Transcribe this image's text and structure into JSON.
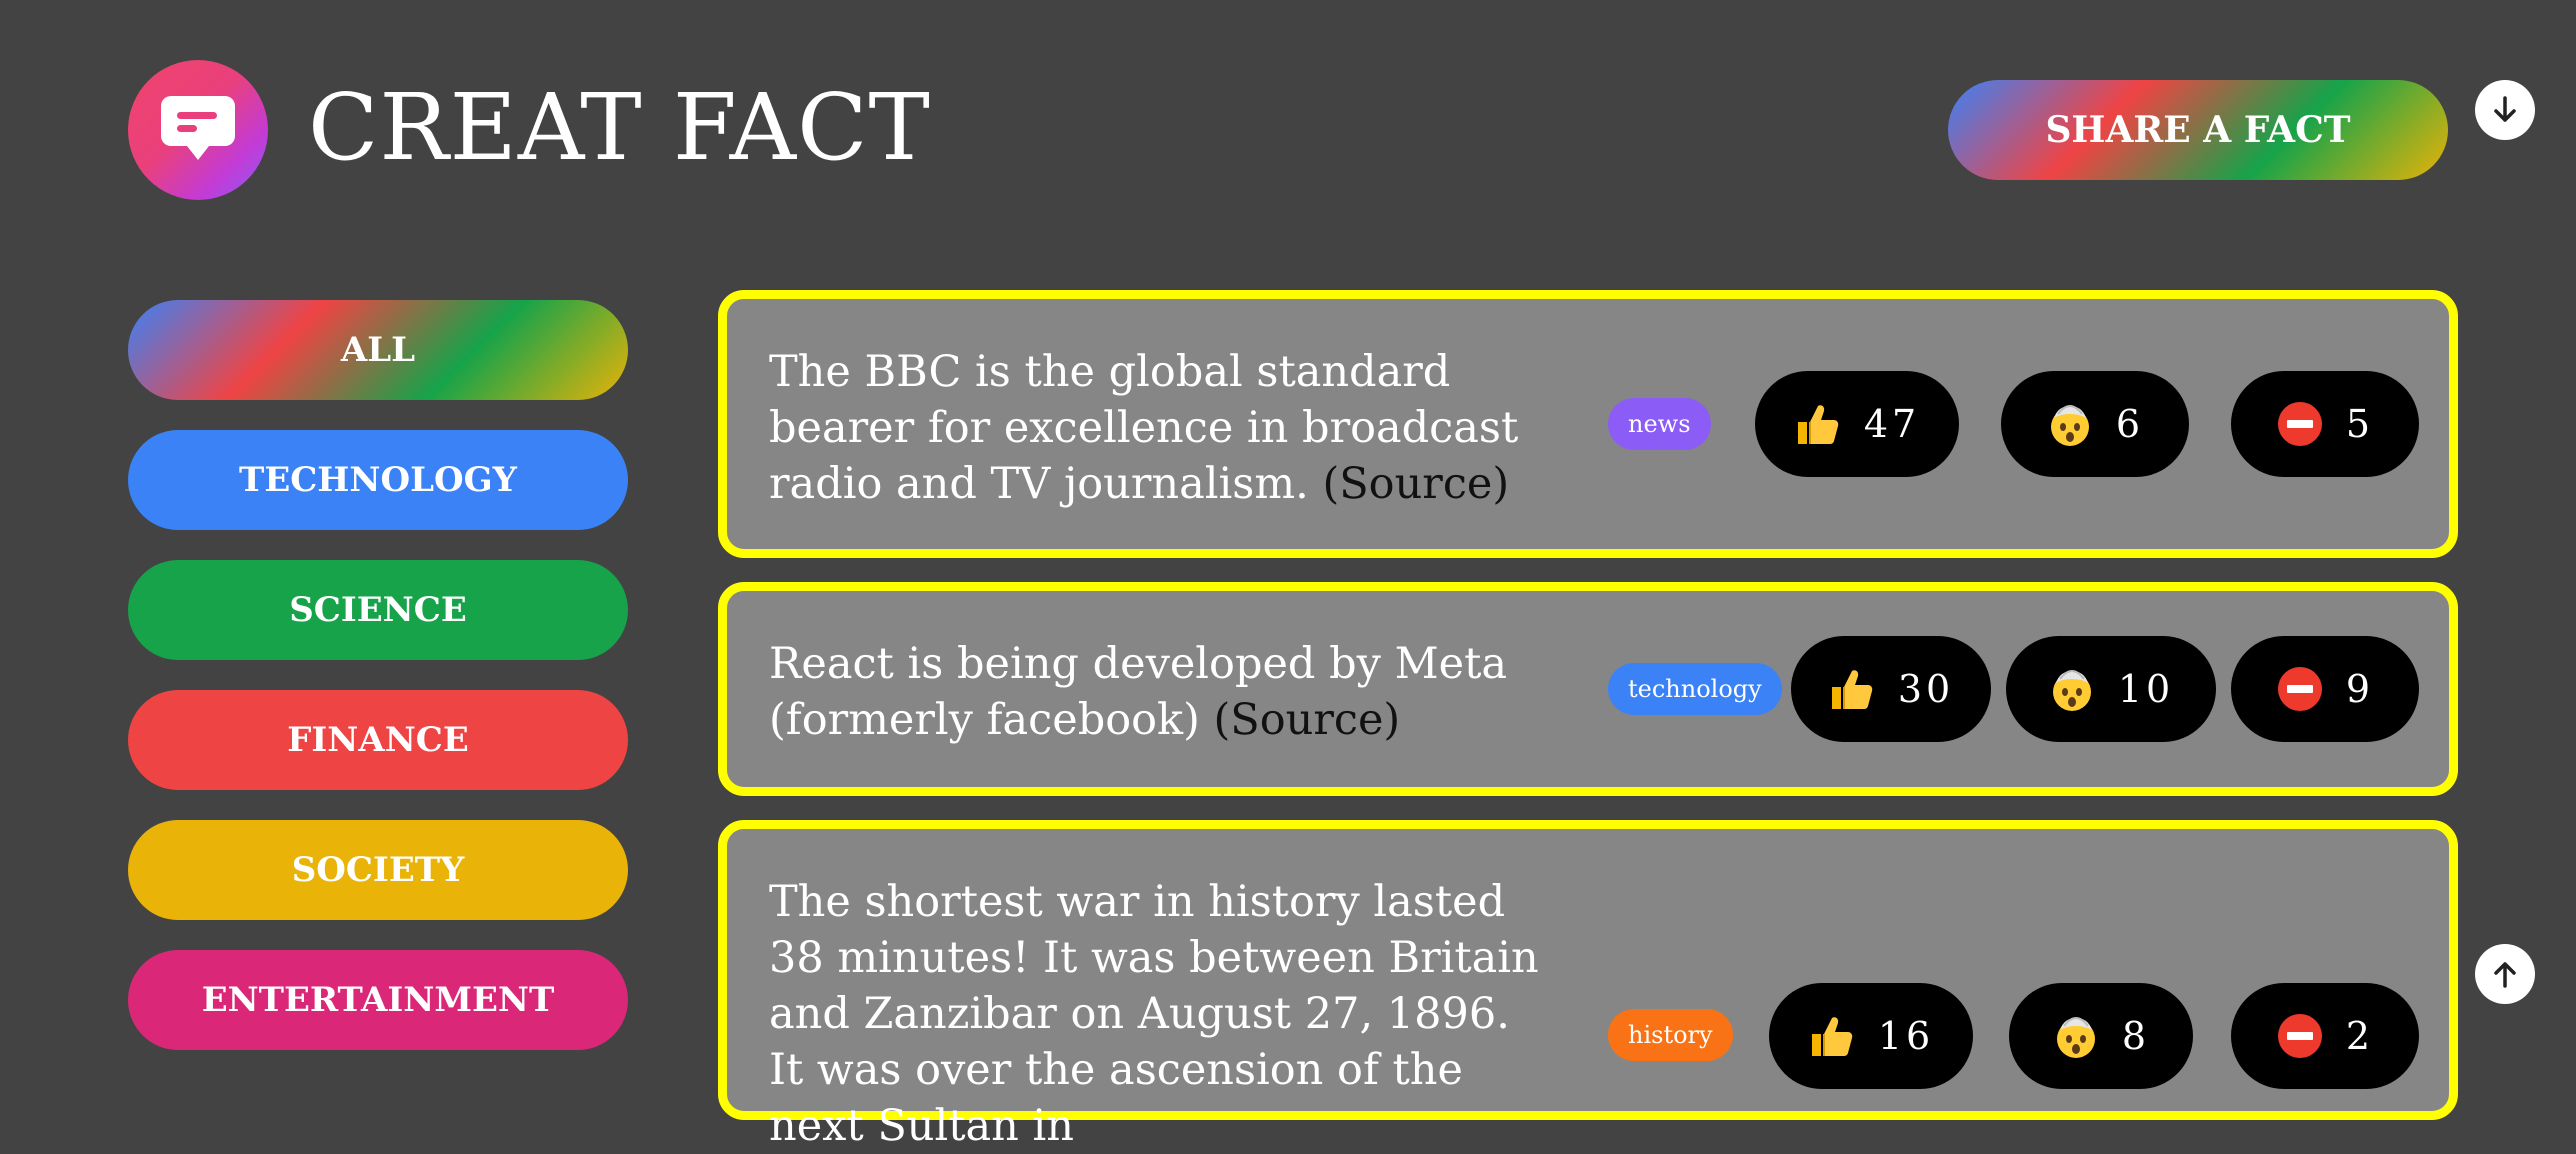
{
  "app": {
    "title": "CREAT FACT",
    "share_label": "SHARE A FACT"
  },
  "categories": [
    {
      "label": "ALL",
      "color": "gradient"
    },
    {
      "label": "TECHNOLOGY",
      "color": "#3b82f6"
    },
    {
      "label": "SCIENCE",
      "color": "#16a34a"
    },
    {
      "label": "FINANCE",
      "color": "#ef4444"
    },
    {
      "label": "SOCIETY",
      "color": "#eab308"
    },
    {
      "label": "ENTERTAINMENT",
      "color": "#db2777"
    }
  ],
  "facts": [
    {
      "text": "The BBC is the global standard bearer for excellence in broadcast radio and TV journalism.",
      "source_label": "(Source)",
      "tag": {
        "label": "news",
        "color": "#8b5cf6"
      },
      "votes": {
        "interesting": "47",
        "mindblowing": "6",
        "false": "5"
      }
    },
    {
      "text": "React is being developed by Meta (formerly facebook)",
      "source_label": "(Source)",
      "tag": {
        "label": "technology",
        "color": "#3b82f6"
      },
      "votes": {
        "interesting": "30",
        "mindblowing": "10",
        "false": "9"
      }
    },
    {
      "text": "The shortest war in history lasted 38 minutes! It was between Britain and Zanzibar on August 27, 1896. It was over the ascension of the next Sultan in",
      "source_label": "",
      "tag": {
        "label": "history",
        "color": "#f97316"
      },
      "votes": {
        "interesting": "16",
        "mindblowing": "8",
        "false": "2"
      }
    }
  ],
  "icons": {
    "logo": "chat-bubble-icon",
    "scroll_down": "arrow-down-icon",
    "scroll_up": "arrow-up-icon",
    "interesting": "thumbs-up-icon",
    "mindblowing": "mind-blown-icon",
    "false": "no-entry-icon"
  },
  "colors": {
    "background": "#434343",
    "card": "#868686",
    "card_border": "#ffff00"
  }
}
